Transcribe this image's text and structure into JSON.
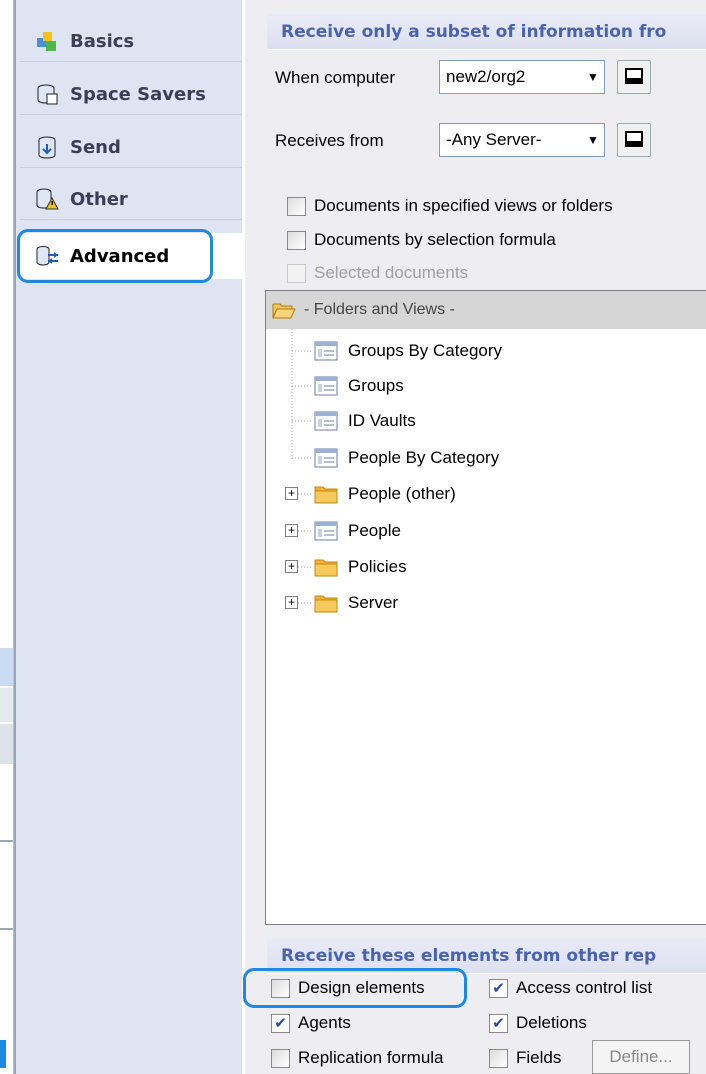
{
  "tabs": [
    {
      "label": "Basics",
      "icon": "basics-icon",
      "active": false
    },
    {
      "label": "Space Savers",
      "icon": "space-savers-icon",
      "active": false
    },
    {
      "label": "Send",
      "icon": "send-icon",
      "active": false
    },
    {
      "label": "Other",
      "icon": "other-icon",
      "active": false
    },
    {
      "label": "Advanced",
      "icon": "advanced-icon",
      "active": true
    }
  ],
  "subset": {
    "header": "Receive only a subset of information fro",
    "when_computer_label": "When computer",
    "when_computer_value": "new2/org2",
    "receives_from_label": "Receives from",
    "receives_from_value": "-Any Server-",
    "options": [
      {
        "label": "Documents in specified views or folders",
        "checked": false,
        "enabled": true
      },
      {
        "label": "Documents by selection formula",
        "checked": false,
        "enabled": true
      },
      {
        "label": "Selected documents",
        "checked": false,
        "enabled": false
      }
    ]
  },
  "tree": {
    "root": "- Folders and Views -",
    "items": [
      {
        "label": "Groups By Category",
        "type": "view",
        "expandable": false
      },
      {
        "label": "Groups",
        "type": "view",
        "expandable": false
      },
      {
        "label": "ID Vaults",
        "type": "view",
        "expandable": false
      },
      {
        "label": "People By Category",
        "type": "view",
        "expandable": false
      },
      {
        "label": "People (other)",
        "type": "folder",
        "expandable": true
      },
      {
        "label": "People",
        "type": "view",
        "expandable": true
      },
      {
        "label": "Policies",
        "type": "folder",
        "expandable": true
      },
      {
        "label": "Server",
        "type": "folder",
        "expandable": true
      }
    ]
  },
  "elements": {
    "header": "Receive these elements from other rep",
    "items": [
      {
        "label": "Design elements",
        "checked": false
      },
      {
        "label": "Access control list",
        "checked": true
      },
      {
        "label": "Agents",
        "checked": true
      },
      {
        "label": "Deletions",
        "checked": true
      },
      {
        "label": "Replication formula",
        "checked": false
      },
      {
        "label": "Fields",
        "checked": false
      }
    ],
    "define_label": "Define..."
  },
  "colors": {
    "accent_highlight": "#1e88e5",
    "section_header_text": "#4a63b0",
    "folder": "#f2b233",
    "check": "#2146b8"
  }
}
